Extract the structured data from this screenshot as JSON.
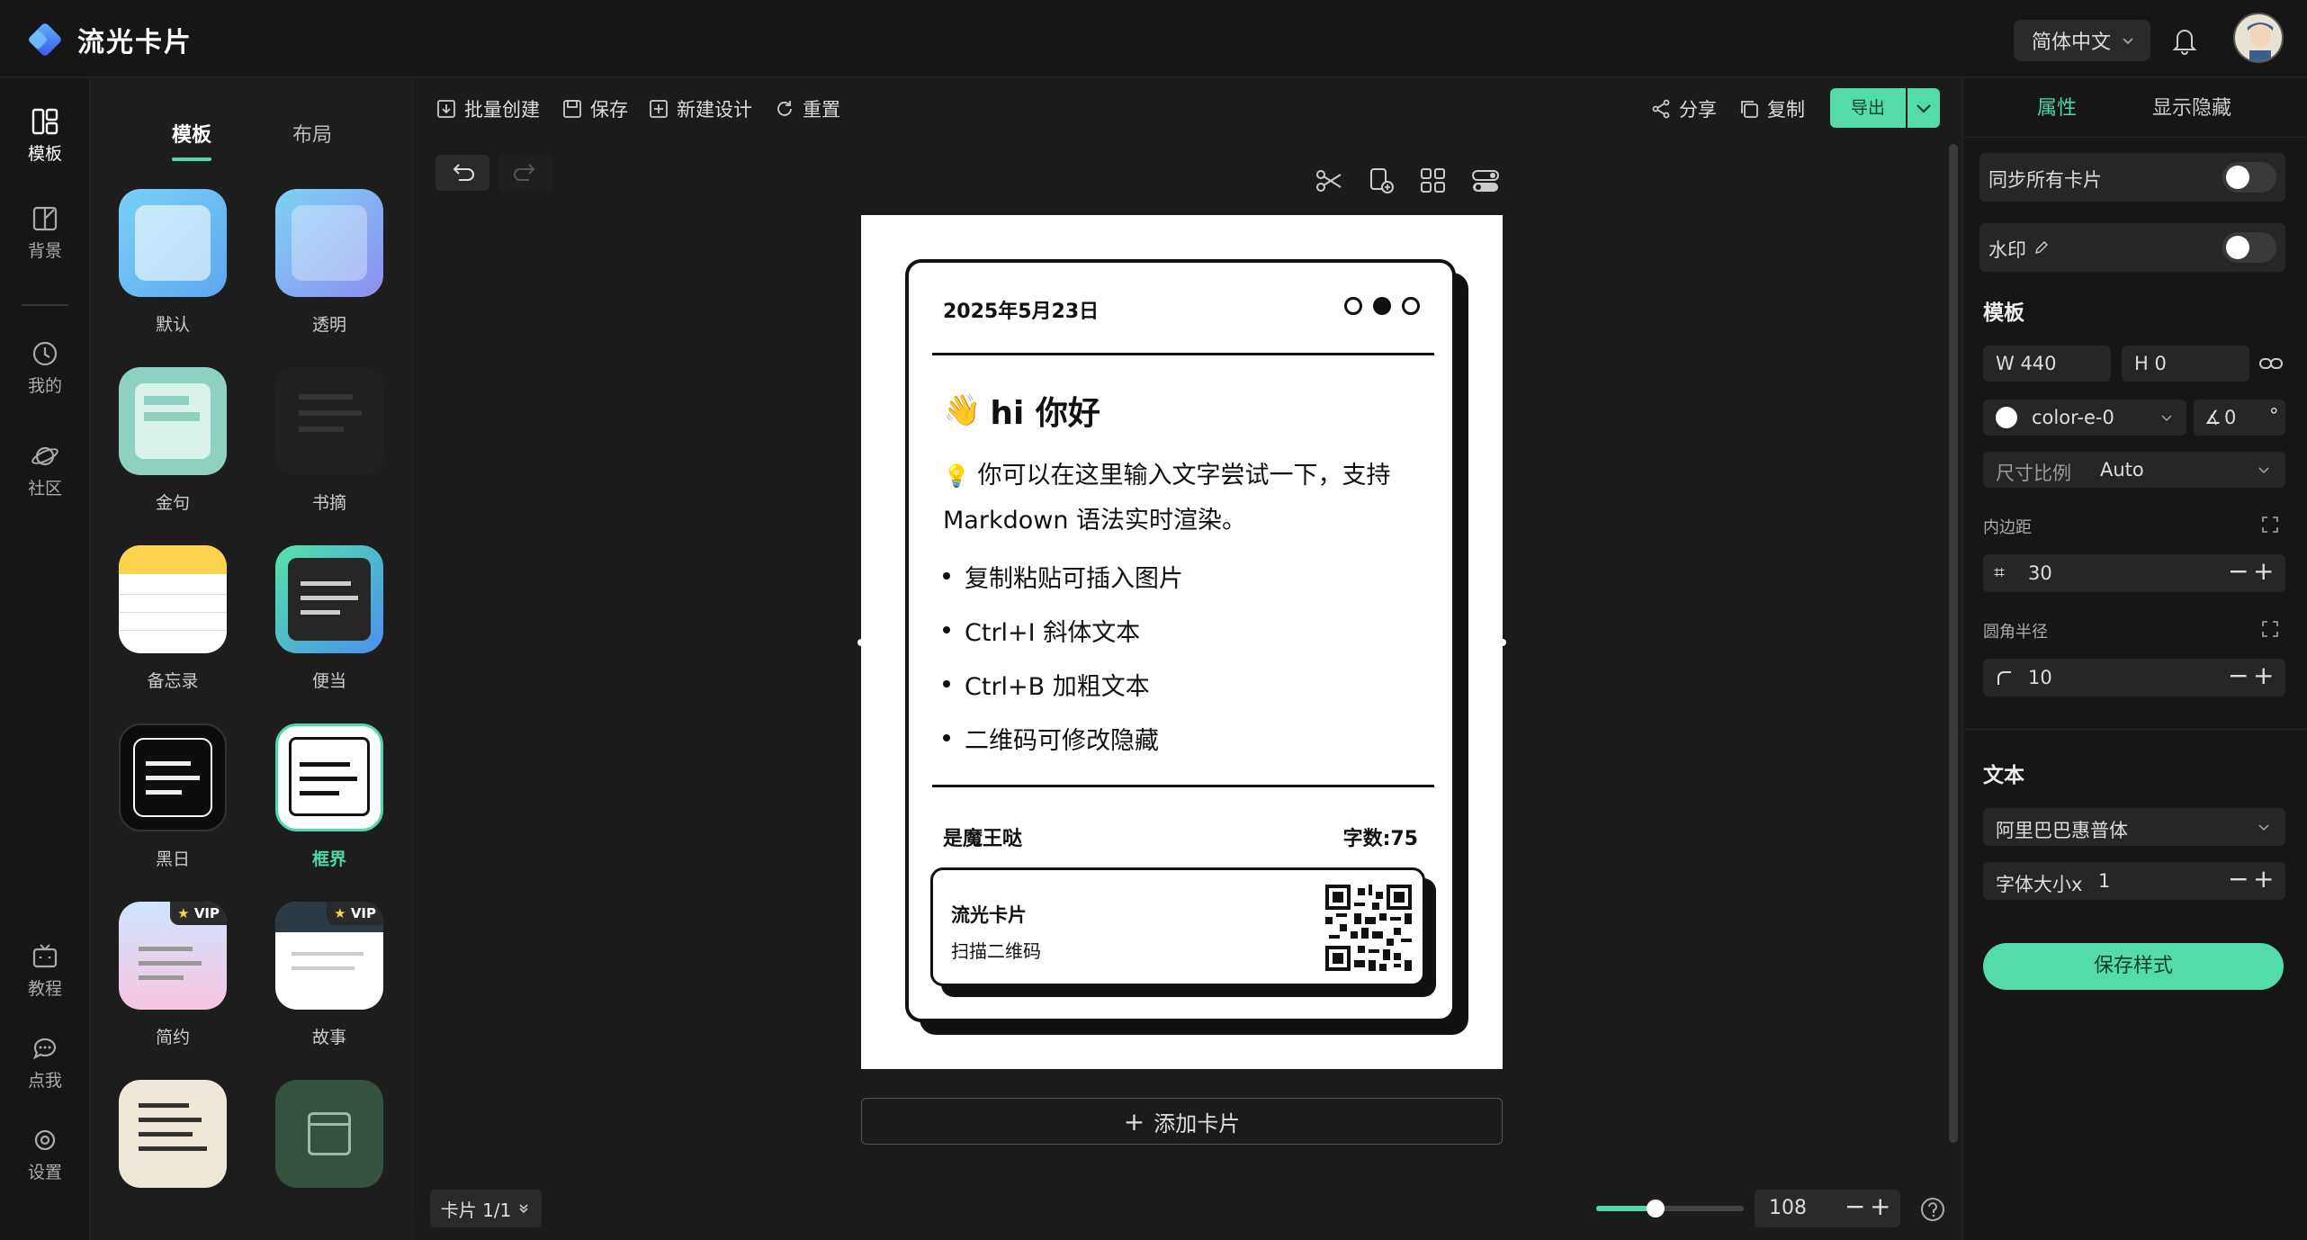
{
  "app": {
    "title": "流光卡片",
    "language": "简体中文"
  },
  "leftnav": {
    "items": [
      {
        "label": "模板",
        "icon": "template-icon"
      },
      {
        "label": "背景",
        "icon": "background-icon"
      },
      {
        "label": "我的",
        "icon": "clock-icon"
      },
      {
        "label": "社区",
        "icon": "planet-icon"
      },
      {
        "label": "教程",
        "icon": "tv-icon"
      },
      {
        "label": "点我",
        "icon": "chat-icon"
      },
      {
        "label": "设置",
        "icon": "settings-icon"
      }
    ]
  },
  "templates": {
    "tabs": [
      "模板",
      "布局"
    ],
    "items": [
      {
        "label": "默认",
        "vip": false
      },
      {
        "label": "透明",
        "vip": false
      },
      {
        "label": "金句",
        "vip": false
      },
      {
        "label": "书摘",
        "vip": false
      },
      {
        "label": "备忘录",
        "vip": false
      },
      {
        "label": "便当",
        "vip": false
      },
      {
        "label": "黑日",
        "vip": false
      },
      {
        "label": "框界",
        "vip": false,
        "selected": true
      },
      {
        "label": "简约",
        "vip": true
      },
      {
        "label": "故事",
        "vip": true
      }
    ],
    "vip_label": "VIP"
  },
  "toolbar": {
    "batch": "批量创建",
    "save": "保存",
    "new_design": "新建设计",
    "reset": "重置",
    "share": "分享",
    "copy": "复制",
    "export": "导出"
  },
  "card": {
    "date": "2025年5月23日",
    "title": "hi 你好",
    "title_emoji": "👋",
    "intro_emoji": "💡",
    "intro": "你可以在这里输入文字尝试一下，支持",
    "intro2": "Markdown 语法实时渲染。",
    "bullets": [
      "复制粘贴可插入图片",
      "Ctrl+I 斜体文本",
      "Ctrl+B 加粗文本",
      "二维码可修改隐藏"
    ],
    "author": "是魔王哒",
    "word_count": "字数:75",
    "qr_title": "流光卡片",
    "qr_subtitle": "扫描二维码"
  },
  "canvas": {
    "add_card": "添加卡片",
    "pager": "卡片 1/1",
    "zoom": "108",
    "zoom_fraction": 0.4
  },
  "props": {
    "tabs": [
      "属性",
      "显示隐藏"
    ],
    "sync_all": "同步所有卡片",
    "watermark": "水印",
    "template_section": "模板",
    "width": "W 440",
    "height": "H 0",
    "color": "color-e-0",
    "angle": "0",
    "degree_mark": "°",
    "ratio_label": "尺寸比例",
    "ratio_value": "Auto",
    "padding_label": "内边距",
    "padding_value": "30",
    "radius_label": "圆角半径",
    "radius_value": "10",
    "text_section": "文本",
    "font_value": "阿里巴巴惠普体",
    "font_size_label": "字体大小x",
    "font_size_value": "1",
    "save_style": "保存样式"
  },
  "colors": {
    "accent": "#4fd8a6",
    "accent_button": "#53dcaa"
  }
}
